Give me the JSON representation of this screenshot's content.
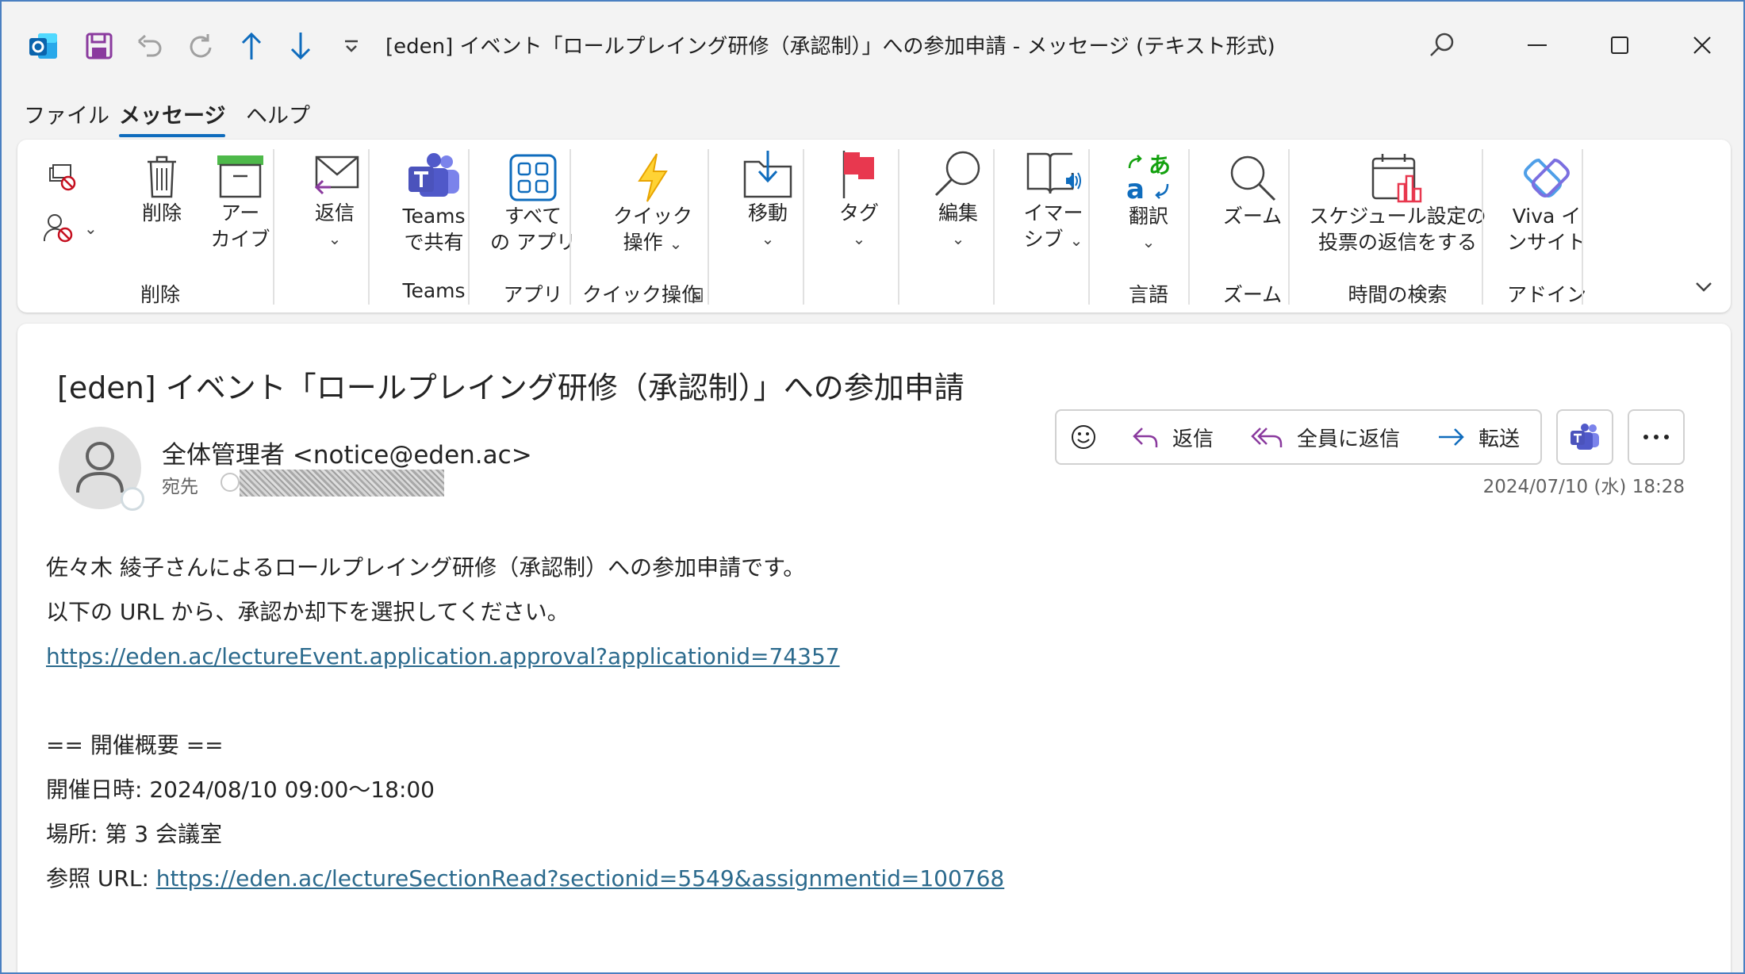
{
  "window": {
    "title": "[eden] イベント「ロールプレイング研修（承認制）」への参加申請  -  メッセージ (テキスト形式)"
  },
  "menu": {
    "tabs": [
      {
        "label": "ファイル"
      },
      {
        "label": "メッセージ"
      },
      {
        "label": "ヘルプ"
      }
    ]
  },
  "ribbon": {
    "delete_label": "削除",
    "archive_label": "アー\nカイブ",
    "archive_l1": "アー",
    "archive_l2": "カイブ",
    "reply_label": "返信",
    "teams_l1": "Teams",
    "teams_l2": "で共有",
    "allapps_l1": "すべて",
    "allapps_l2": "の アプリ",
    "quick_l1": "クイック",
    "quick_l2": "操作",
    "move_label": "移動",
    "tag_label": "タグ",
    "edit_label": "編集",
    "immersive_l1": "イマー",
    "immersive_l2": "シブ",
    "translate_label": "翻訳",
    "zoom_label": "ズーム",
    "schedule_l1": "スケジュール設定の",
    "schedule_l2": "投票の返信をする",
    "viva_l1": "Viva イ",
    "viva_l2": "ンサイト",
    "groups": {
      "delete": "削除",
      "teams": "Teams",
      "apps": "アプリ",
      "quick": "クイック操作",
      "language": "言語",
      "zoom": "ズーム",
      "time": "時間の検索",
      "addin": "アドイン"
    }
  },
  "message": {
    "subject": "[eden] イベント「ロールプレイング研修（承認制）」への参加申請",
    "sender": "全体管理者 <notice@eden.ac>",
    "to_label": "宛先",
    "date": "2024/07/10 (水) 18:28",
    "actions": {
      "reply": "返信",
      "reply_all": "全員に返信",
      "forward": "転送"
    },
    "body": {
      "line1": "佐々木 綾子さんによるロールプレイング研修（承認制）への参加申請です。",
      "line2": "以下の URL から、承認か却下を選択してください。",
      "link1": "https://eden.ac/lectureEvent.application.approval?applicationid=74357",
      "line4": "== 開催概要 ==",
      "line5": "開催日時: 2024/08/10 09:00～18:00",
      "line6": "場所: 第 3 会議室",
      "line7_prefix": "参照 URL: ",
      "link2": "https://eden.ac/lectureSectionRead?sectionid=5549&assignmentid=100768"
    }
  },
  "colors": {
    "accent": "#0f6cbd",
    "link": "#2b6a8d",
    "window_border": "#4a7fc1"
  }
}
